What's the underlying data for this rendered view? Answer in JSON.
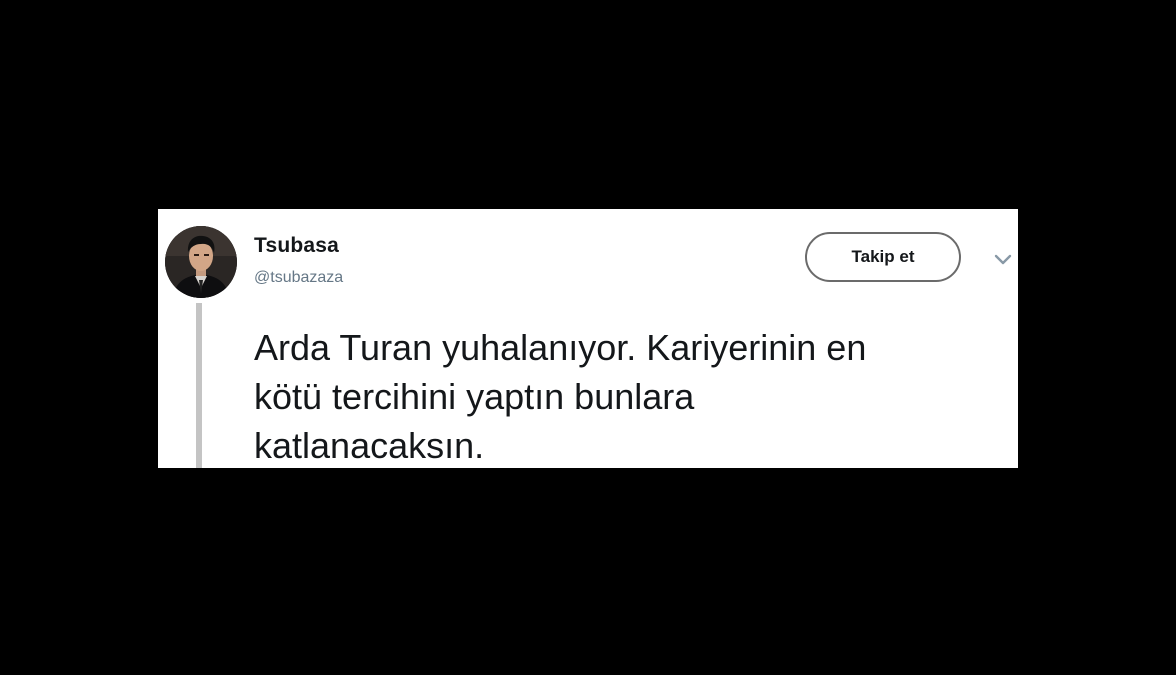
{
  "tweet": {
    "author": {
      "display_name": "Tsubasa",
      "handle": "@tsubazaza"
    },
    "follow_label": "Takip et",
    "text": "Arda Turan yuhalanıyor. Kariyerinin en\nkötü tercihini yaptın bunlara\nkatlanacaksın."
  },
  "icons": {
    "avatar": "profile-photo",
    "menu": "chevron-down-icon"
  },
  "colors": {
    "background": "#000000",
    "card": "#ffffff",
    "text": "#14171a",
    "handle": "#657786",
    "thread_line": "#c4c4c4"
  }
}
